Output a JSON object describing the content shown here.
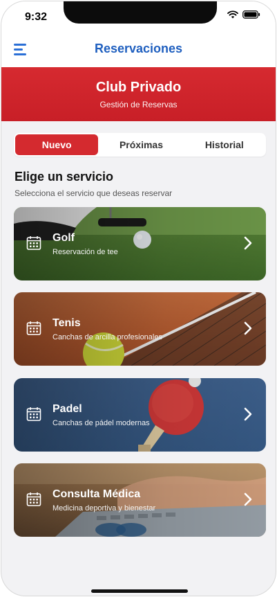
{
  "status": {
    "time": "9:32"
  },
  "navbar": {
    "title": "Reservaciones"
  },
  "hero": {
    "title": "Club Privado",
    "subtitle": "Gestión de Reservas"
  },
  "tabs": [
    {
      "label": "Nuevo",
      "active": true
    },
    {
      "label": "Próximas",
      "active": false
    },
    {
      "label": "Historial",
      "active": false
    }
  ],
  "section": {
    "title": "Elige un servicio",
    "subtitle": "Selecciona el servicio que deseas reservar"
  },
  "services": [
    {
      "title": "Golf",
      "subtitle": "Reservación de tee"
    },
    {
      "title": "Tenis",
      "subtitle": "Canchas de arcilla profesionales"
    },
    {
      "title": "Padel",
      "subtitle": "Canchas de pádel modernas"
    },
    {
      "title": "Consulta Médica",
      "subtitle": "Medicina deportiva y bienestar"
    }
  ],
  "colors": {
    "accent": "#d42a2f",
    "nav_blue": "#1f5fbf"
  }
}
